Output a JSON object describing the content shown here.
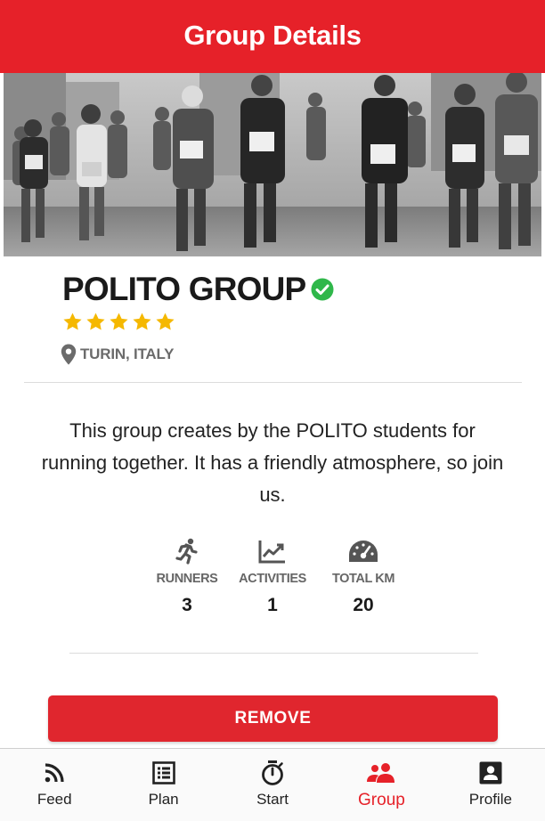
{
  "header": {
    "title": "Group Details"
  },
  "group": {
    "name": "POLITO GROUP",
    "rating": 5,
    "rating_max": 5,
    "location": "TURIN, ITALY",
    "description": "This group creates by the POLITO students for running together. It has a friendly atmosphere, so join us."
  },
  "stats": [
    {
      "icon": "runner-icon",
      "label": "RUNNERS",
      "value": "3"
    },
    {
      "icon": "trending-chart-icon",
      "label": "ACTIVITIES",
      "value": "1"
    },
    {
      "icon": "speedometer-icon",
      "label": "TOTAL KM",
      "value": "20"
    }
  ],
  "actions": {
    "remove_label": "REMOVE"
  },
  "tabbar": {
    "active": "Group",
    "items": [
      {
        "icon": "rss-feed-icon",
        "label": "Feed"
      },
      {
        "icon": "list-alt-icon",
        "label": "Plan"
      },
      {
        "icon": "stopwatch-icon",
        "label": "Start"
      },
      {
        "icon": "group-icon",
        "label": "Group"
      },
      {
        "icon": "account-box-icon",
        "label": "Profile"
      }
    ]
  },
  "colors": {
    "primary": "#e62129",
    "verified": "#2fb74a",
    "star": "#f5b800",
    "muted_text": "#6b6b6b"
  }
}
